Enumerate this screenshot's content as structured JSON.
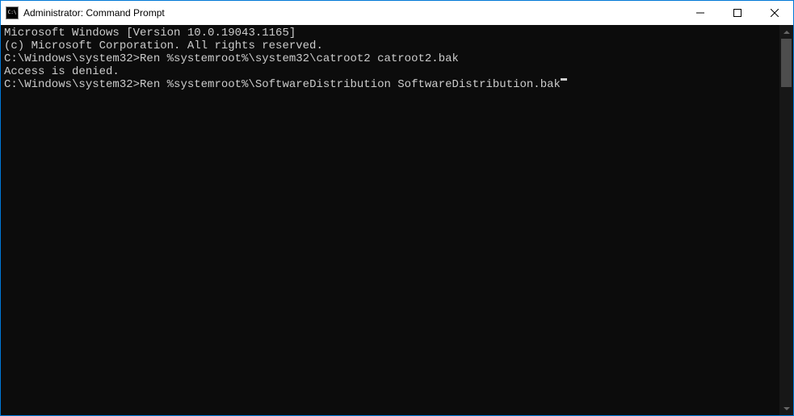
{
  "titlebar": {
    "title": "Administrator: Command Prompt"
  },
  "console": {
    "line1": "Microsoft Windows [Version 10.0.19043.1165]",
    "line2": "(c) Microsoft Corporation. All rights reserved.",
    "blank1": "",
    "prompt1": "C:\\Windows\\system32>",
    "cmd1": "Ren %systemroot%\\system32\\catroot2 catroot2.bak",
    "result1": "Access is denied.",
    "blank2": "",
    "prompt2": "C:\\Windows\\system32>",
    "cmd2": "Ren %systemroot%\\SoftwareDistribution SoftwareDistribution.bak"
  }
}
